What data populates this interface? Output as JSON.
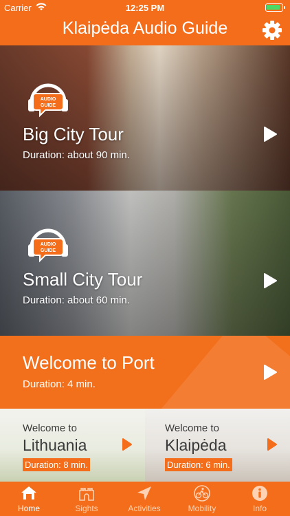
{
  "status_bar": {
    "carrier": "Carrier",
    "time": "12:25 PM"
  },
  "nav": {
    "title": "Klaipėda Audio Guide"
  },
  "tours": [
    {
      "title": "Big City Tour",
      "duration": "Duration: about 90 min.",
      "badge_text": "AUDIO GUIDE"
    },
    {
      "title": "Small City Tour",
      "duration": "Duration: about 60 min.",
      "badge_text": "AUDIO GUIDE"
    }
  ],
  "port": {
    "title": "Welcome to Port",
    "duration": "Duration: 4 min."
  },
  "mini_tours": [
    {
      "line1": "Welcome to",
      "line2": "Lithuania",
      "duration": "Duration: 8 min."
    },
    {
      "line1": "Welcome to",
      "line2": "Klaipėda",
      "duration": "Duration: 6 min."
    }
  ],
  "tabs": [
    {
      "label": "Home",
      "icon": "home-icon",
      "active": true
    },
    {
      "label": "Sights",
      "icon": "castle-icon",
      "active": false
    },
    {
      "label": "Activities",
      "icon": "navigation-arrow-icon",
      "active": false
    },
    {
      "label": "Mobility",
      "icon": "bicycle-icon",
      "active": false
    },
    {
      "label": "Info",
      "icon": "info-icon",
      "active": false
    }
  ],
  "colors": {
    "accent": "#f36d1a",
    "battery": "#4cd964"
  }
}
